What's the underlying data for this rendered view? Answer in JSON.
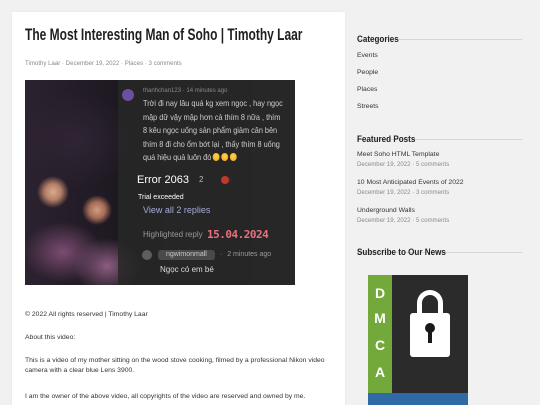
{
  "post": {
    "title": "The Most Interesting Man of Soho | Timothy Laar",
    "meta": {
      "author": "Timothy Laar",
      "date": "December 19, 2022",
      "category": "Places",
      "comments": "3 comments",
      "separator": "·"
    },
    "video": {
      "separator": "·",
      "comment": {
        "username": "thanhchan123",
        "time": "14 minutes ago",
        "lines": [
          "Trời đi nay lâu quá kg xem ngọc , hay ngọc",
          "mập dữ vậy mập hơn cả thím 8 nữa , thím",
          "8 kêu ngọc uống sản phẩm giảm cân bên",
          "thím 8 đi cho ổm bớt lại , thấy thím 8 uống",
          "quá hiệu quả luôn đó"
        ],
        "reaction_icons": [
          "laughing-face-icon",
          "laughing-face-icon",
          "laughing-face-icon"
        ],
        "like_count": "2"
      },
      "player_error": {
        "code": "Error 2063",
        "message": "Trial exceeded"
      },
      "view_replies": "View all 2 replies",
      "highlighted_label": "Highlighted reply",
      "highlighted_date": "15.04.2024",
      "reply": {
        "username": "ngwimonmall",
        "time": "2 minutes ago",
        "text": "Ngọc có em bé"
      }
    },
    "copyright": "© 2022 All rights reserved | Timothy Laar",
    "about_label": "About this video:",
    "description_lines": [
      "This is a video of my mother sitting on the wood stove cooking, filmed by a professional Nikon video",
      "camera with a clear blue Lens 3900."
    ],
    "ownership": "I am the owner of the above video, all copyrights of the video are reserved and owned by me."
  },
  "sidebar": {
    "categories": {
      "heading": "Categories",
      "items": [
        "Events",
        "People",
        "Places",
        "Streets"
      ]
    },
    "featured": {
      "heading": "Featured Posts",
      "posts": [
        {
          "title": "Meet Soho HTML Template",
          "meta": "December 19, 2022 · 5 comments"
        },
        {
          "title": "10 Most Anticipated Events of 2022",
          "meta": "December 19, 2022 · 3 comments"
        },
        {
          "title": "Underground Walls",
          "meta": "December 19, 2022 · 5 comments"
        }
      ]
    },
    "subscribe": {
      "heading": "Subscribe to Our News"
    },
    "dmca_badge": {
      "letters": [
        "D",
        "M",
        "C",
        "A"
      ],
      "icon": "padlock-icon"
    }
  },
  "colors": {
    "page_background": "#f1f1f1",
    "card_background": "#ffffff",
    "title_text": "#1e1e1e",
    "meta_text": "#8a8a8a",
    "highlight_date": "#e9707c",
    "view_replies": "#a3acd6",
    "dmca_green": "#73a83a",
    "dmca_dark": "#2b2b2b",
    "dmca_blue": "#2f6aa7"
  }
}
